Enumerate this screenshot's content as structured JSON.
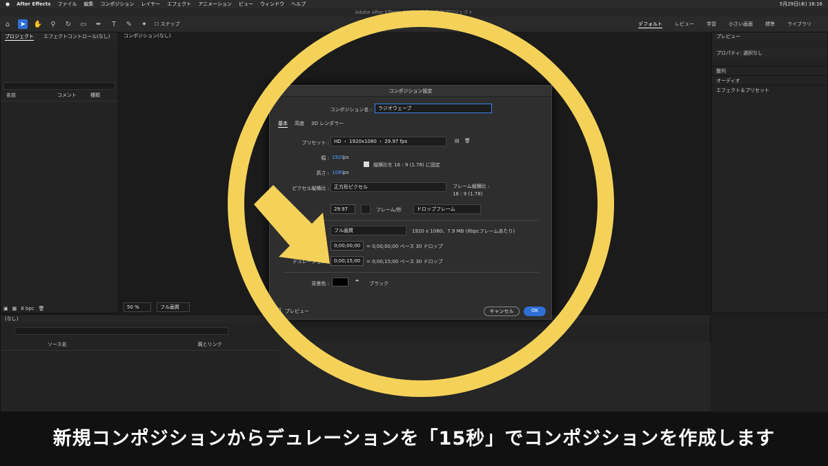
{
  "menubar": {
    "app": "After Effects",
    "items": [
      "ファイル",
      "編集",
      "コンポジション",
      "レイヤー",
      "エフェクト",
      "アニメーション",
      "ビュー",
      "ウィンドウ",
      "ヘルプ"
    ],
    "date": "5月29日(木) 16:16"
  },
  "window_title": "Adobe After Effects 2025 - 名称未設定プロジェクト",
  "toolbar": {
    "snap": "スナップ",
    "workspaces": [
      "デフォルト",
      "レビュー",
      "学習",
      "小さい画面",
      "標準",
      "ライブラリ"
    ]
  },
  "left": {
    "tab_project": "プロジェクト",
    "tab_effects": "エフェクトコントロール(なし)",
    "col_name": "名前",
    "col_comment": "コメント",
    "col_type": "種類",
    "bpc": "8 bpc"
  },
  "viewer": {
    "tab": "コンポジション(なし)",
    "zoom": "50 %",
    "quality": "フル画質"
  },
  "right": {
    "preview": "プレビュー",
    "properties": "プロパティ: 選択なし",
    "align": "整列",
    "audio": "オーディオ",
    "effects": "エフェクト＆プリセット"
  },
  "timeline": {
    "tab": "(なし)",
    "col_source": "ソース名",
    "col_parent": "親とリンク"
  },
  "dialog": {
    "title": "コンポジション設定",
    "name_label": "コンポジション名 :",
    "name_value": "ラジオウェーブ",
    "tabs": [
      "基本",
      "高度",
      "3D レンダラー"
    ],
    "preset_label": "プリセット :",
    "preset_value": "HD ・ 1920x1080 ・ 29.97 fps",
    "width_label": "幅 :",
    "width_value": "1920",
    "unit": "px",
    "height_label": "高さ :",
    "height_value": "1080",
    "lock_label": "縦横比を 16 : 9 (1.78) に固定",
    "par_label": "ピクセル縦横比 :",
    "par_value": "正方形ピクセル",
    "frame_aspect_label": "フレーム縦横比 :",
    "frame_aspect_value": "16 : 9 (1.78)",
    "fps_value": "29.97",
    "fps_unit": "フレーム/秒",
    "drop": "ドロップフレーム",
    "res_value": "フル画質",
    "res_info": "1920 x 1080、7.9 MB (8bpcフレームあたり)",
    "start_value": "0;00;00;00",
    "start_info": "= 0;00;00;00  ベース 30  ドロップ",
    "dur_label": "デュレーション :",
    "dur_value": "0;00;15;00",
    "dur_info": "= 0;00;15;00  ベース 30  ドロップ",
    "bg_label": "背景色 :",
    "bg_name": "ブラック",
    "preview": "プレビュー",
    "cancel": "キャンセル",
    "ok": "OK"
  },
  "caption": "新規コンポジションからデュレーションを「15秒」でコンポジションを作成します",
  "colors": {
    "ring": "#f4d25a",
    "accent": "#2f6fd6"
  }
}
